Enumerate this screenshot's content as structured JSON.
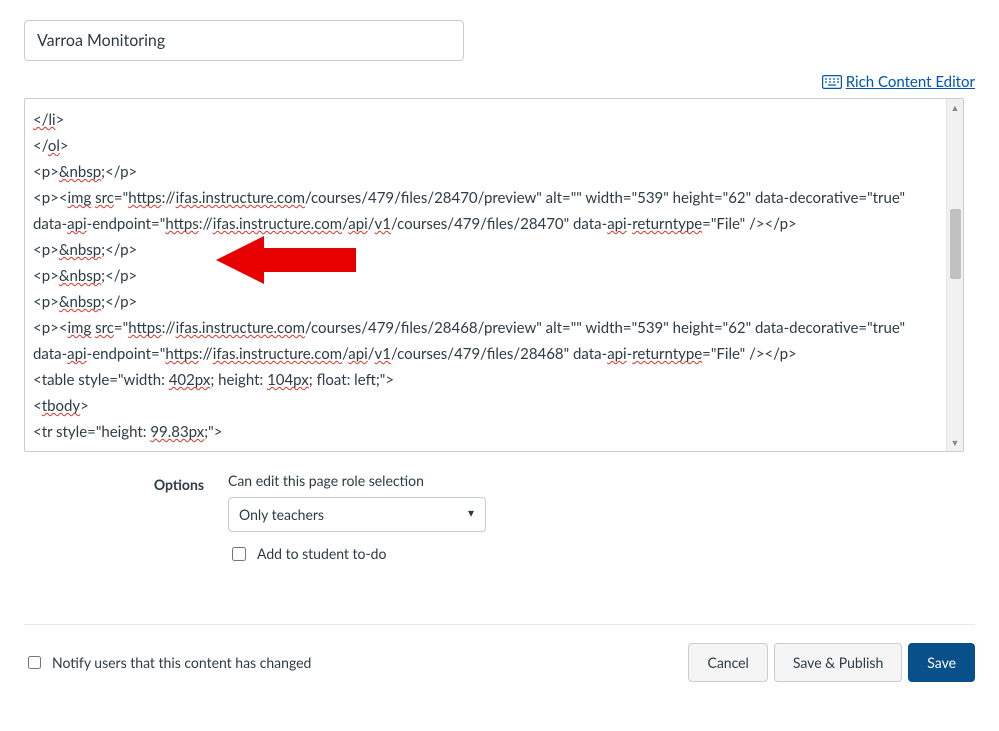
{
  "title_value": "Varroa Monitoring",
  "rce_link_label": "Rich Content Editor",
  "code_html": "<span class=\"wavy\">&lt;/li</span>&gt;<br>&lt;/<span class=\"wavy\">ol</span>&gt;<br>&lt;p&gt;<span class=\"wavy\">&amp;nbsp</span>;&lt;/p&gt;<br>&lt;p&gt;&lt;<span class=\"wavy\">img</span> <span class=\"wavy\">src</span>=\"<span class=\"wavy\">https</span>://<span class=\"wavy\">ifas.instructure.com</span>/courses/479/files/28470/preview\" alt=\"\" width=\"539\" height=\"62\" data-decorative=\"true\" data-<span class=\"wavy\">api</span>-endpoint=\"<span class=\"wavy\">https</span>://<span class=\"wavy\">ifas.instructure.com</span>/<span class=\"wavy\">api</span>/<span class=\"wavy\">v1</span>/courses/479/files/28470\" data-<span class=\"wavy\">api</span>-<span class=\"wavy\">returntype</span>=\"File\" /&gt;&lt;/p&gt;<br>&lt;p&gt;<span class=\"wavy\">&amp;nbsp</span>;&lt;/p&gt;<br>&lt;p&gt;<span class=\"wavy\">&amp;nbsp</span>;&lt;/p&gt;<br>&lt;p&gt;<span class=\"wavy\">&amp;nbsp</span>;&lt;/p&gt;<br>&lt;p&gt;&lt;<span class=\"wavy\">img</span> <span class=\"wavy\">src</span>=\"<span class=\"wavy\">https</span>://<span class=\"wavy\">ifas.instructure.com</span>/courses/479/files/28468/preview\" alt=\"\" width=\"539\" height=\"62\" data-decorative=\"true\" data-<span class=\"wavy\">api</span>-endpoint=\"<span class=\"wavy\">https</span>://<span class=\"wavy\">ifas.instructure.com</span>/<span class=\"wavy\">api</span>/<span class=\"wavy\">v1</span>/courses/479/files/28468\" data-<span class=\"wavy\">api</span>-<span class=\"wavy\">returntype</span>=\"File\" /&gt;&lt;/p&gt;<br>&lt;table style=\"width: <span class=\"wavy\">402px</span>; height: <span class=\"wavy\">104px</span>; float: left;\"&gt;<br>&lt;<span class=\"wavy\">tbody</span>&gt;<br>&lt;tr style=\"height: <span class=\"wavy\">99.83px</span>;\"&gt;",
  "options": {
    "heading": "Options",
    "role_label": "Can edit this page role selection",
    "role_selected": "Only teachers",
    "add_todo_label": "Add to student to-do"
  },
  "footer": {
    "notify_label": "Notify users that this content has changed",
    "cancel": "Cancel",
    "save_publish": "Save & Publish",
    "save": "Save"
  }
}
